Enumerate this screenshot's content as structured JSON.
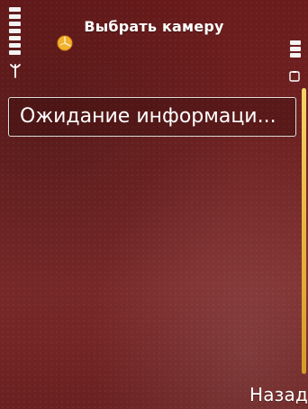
{
  "header": {
    "title": "Выбрать камеру",
    "signal_icon": "signal-strength-icon",
    "status_icon": "orange-status-icon",
    "battery_icon": "battery-icon",
    "signal_level": 1.0,
    "battery_level": 0.6
  },
  "list": {
    "items": [
      {
        "label": "Ожидание информаци..."
      }
    ]
  },
  "softkeys": {
    "right": "Назад"
  },
  "colors": {
    "background": "#7a2727",
    "accent": "#f2c54a",
    "text": "#ffffff"
  }
}
